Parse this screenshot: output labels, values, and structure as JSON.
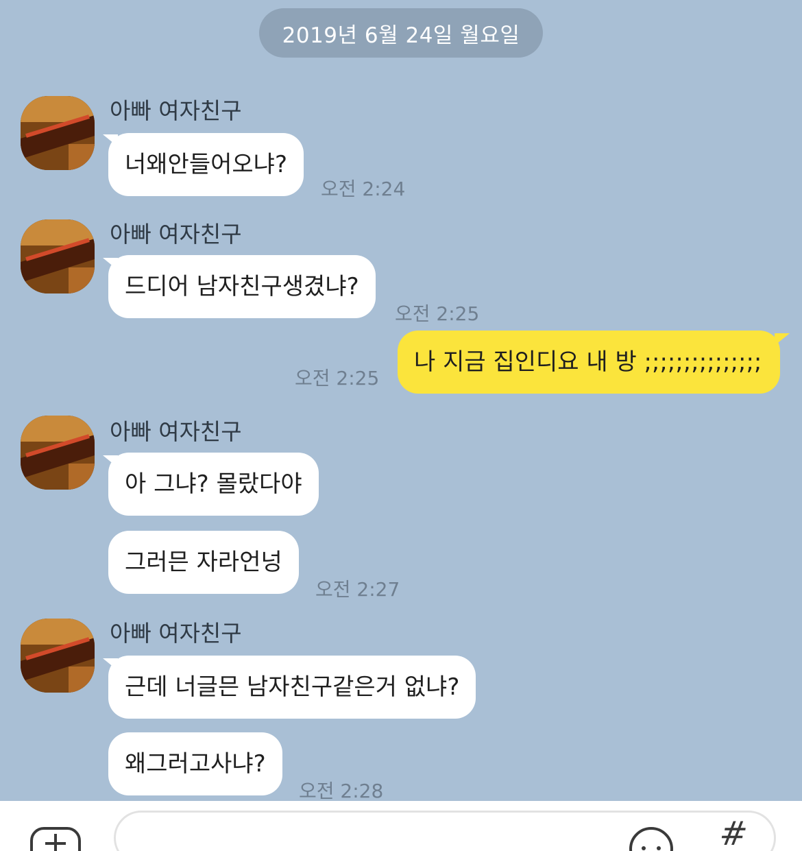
{
  "date_divider": "2019년 6월 24일 월요일",
  "sender": {
    "name": "아빠 여자친구"
  },
  "messages": [
    {
      "text": "너왜안들어오냐?",
      "time": "오전 2:24"
    },
    {
      "text": "드디어 남자친구생겼냐?",
      "time": "오전 2:25"
    },
    {
      "text": "나 지금 집인디요 내 방 ;;;;;;;;;;;;;;;",
      "time": "오전 2:25"
    },
    {
      "text": "아 그냐? 몰랐다야",
      "time": ""
    },
    {
      "text": "그러믄 자라언넝",
      "time": "오전 2:27"
    },
    {
      "text": "근데 너글믄 남자친구같은거 없냐?",
      "time": ""
    },
    {
      "text": "왜그러고사냐?",
      "time": "오전 2:28"
    }
  ],
  "composer": {
    "placeholder": "",
    "icons": [
      "plus-icon",
      "emoji-icon",
      "hash-icon"
    ]
  },
  "colors": {
    "chat_background": "#a9bfd5",
    "incoming_bubble": "#ffffff",
    "outgoing_bubble": "#fbe43c",
    "date_pill": "#8fa3b7"
  }
}
